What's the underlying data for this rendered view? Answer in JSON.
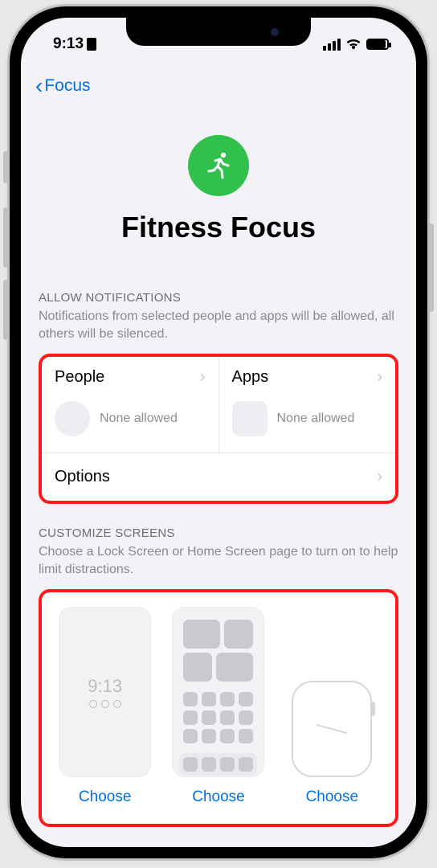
{
  "status": {
    "time": "9:13"
  },
  "nav": {
    "back_label": "Focus"
  },
  "hero": {
    "title": "Fitness Focus"
  },
  "notifications": {
    "header": "ALLOW NOTIFICATIONS",
    "description": "Notifications from selected people and apps will be allowed, all others will be silenced.",
    "people_label": "People",
    "people_status": "None allowed",
    "apps_label": "Apps",
    "apps_status": "None allowed",
    "options_label": "Options"
  },
  "customize": {
    "header": "CUSTOMIZE SCREENS",
    "description": "Choose a Lock Screen or Home Screen page to turn on to help limit distractions.",
    "lock_time": "9:13",
    "choose_label": "Choose"
  }
}
